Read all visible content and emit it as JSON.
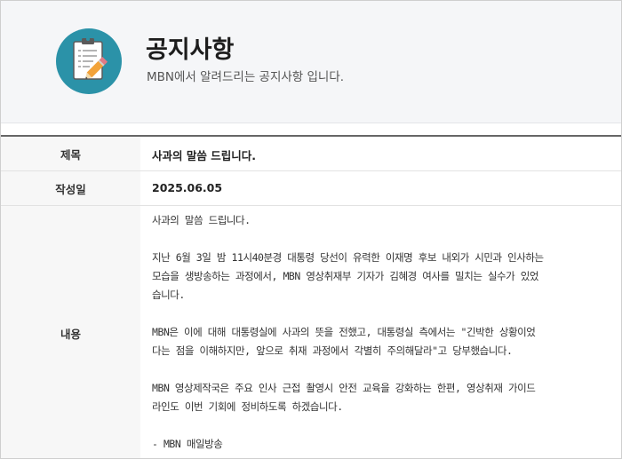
{
  "header": {
    "title": "공지사항",
    "subtitle": "MBN에서 알려드리는 공지사항 입니다.",
    "logo_icon": "clipboard-pencil-icon",
    "logo_color": "#2b92a8"
  },
  "notice": {
    "subject_label": "제목",
    "subject_value": "사과의 말씀 드립니다.",
    "date_label": "작성일",
    "date_value": "2025.06.05",
    "content_label": "내용",
    "content_lines": [
      "사과의 말씀 드립니다.",
      "",
      "지난 6월 3일 밤 11시40분경 대통령 당선이 유력한 이재명 후보 내외가 시민과 인사하는",
      "모습을 생방송하는 과정에서, MBN 영상취재부 기자가 김혜경 여사를 밀치는 실수가 있었",
      "습니다.",
      "",
      "MBN은 이에 대해 대통령실에 사과의 뜻을 전했고, 대통령실 측에서는 \"긴박한 상황이었",
      "다는 점을 이해하지만, 앞으로 취재 과정에서 각별히 주의해달라\"고 당부했습니다.",
      "",
      "MBN 영상제작국은 주요 인사 근접 촬영시 안전 교육을 강화하는 한편, 영상취재 가이드",
      "라인도 이번 기회에 정비하도록 하겠습니다.",
      "",
      "- MBN 매일방송"
    ]
  }
}
